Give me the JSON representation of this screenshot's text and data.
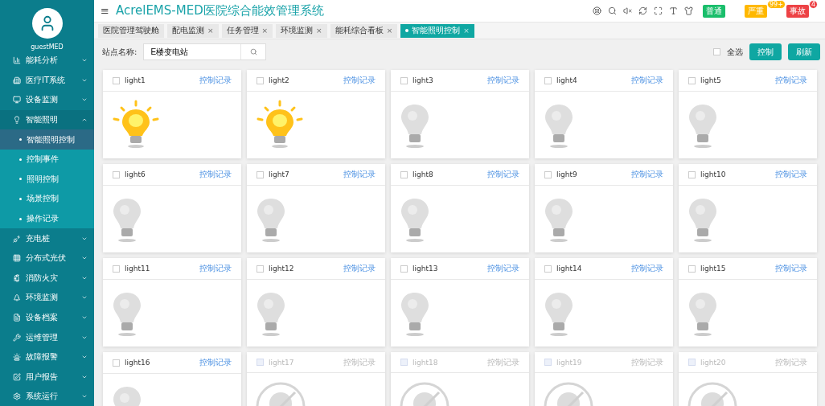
{
  "user": {
    "name": "guestMED"
  },
  "sidebar": {
    "items": [
      {
        "label": "能耗分析",
        "expanded": false
      },
      {
        "label": "医疗IT系统",
        "expanded": false
      },
      {
        "label": "设备监测",
        "expanded": false
      },
      {
        "label": "智能照明",
        "expanded": true,
        "children": [
          {
            "label": "智能照明控制",
            "selected": true
          },
          {
            "label": "控制事件",
            "selected": false
          },
          {
            "label": "照明控制",
            "selected": false
          },
          {
            "label": "场景控制",
            "selected": false
          },
          {
            "label": "操作记录",
            "selected": false
          }
        ]
      },
      {
        "label": "充电桩",
        "expanded": false
      },
      {
        "label": "分布式光伏",
        "expanded": false
      },
      {
        "label": "消防火灾",
        "expanded": false
      },
      {
        "label": "环境监测",
        "expanded": false
      },
      {
        "label": "设备档案",
        "expanded": false
      },
      {
        "label": "运维管理",
        "expanded": false
      },
      {
        "label": "故障报警",
        "expanded": false
      },
      {
        "label": "用户报告",
        "expanded": false
      },
      {
        "label": "系统运行",
        "expanded": false
      }
    ]
  },
  "header": {
    "menu_glyph": "≡",
    "title": "AcrelEMS-MED医院综合能效管理系统",
    "alerts": [
      {
        "label": "普通",
        "color": "#19be6b"
      },
      {
        "label": "严重",
        "color": "#ffb800",
        "count": "99+"
      },
      {
        "label": "事故",
        "color": "#ed4245",
        "count": "4"
      }
    ]
  },
  "tabs": [
    {
      "label": "医院管理驾驶舱",
      "selected": false,
      "closable": false
    },
    {
      "label": "配电监测",
      "selected": false,
      "closable": true
    },
    {
      "label": "任务管理",
      "selected": false,
      "closable": true
    },
    {
      "label": "环境监测",
      "selected": false,
      "closable": true
    },
    {
      "label": "能耗综合看板",
      "selected": false,
      "closable": true
    },
    {
      "label": "智能照明控制",
      "selected": true,
      "closable": true
    }
  ],
  "tab_close_glyph": "×",
  "toolbar": {
    "site_label": "站点名称:",
    "site_value": "E楼变电站",
    "select_all": {
      "label": "全选",
      "checked": false
    },
    "buttons": [
      "控制",
      "刷新"
    ]
  },
  "lights": [
    {
      "name": "light1",
      "kind": "lit",
      "checked": false,
      "link": "控制记录"
    },
    {
      "name": "light2",
      "kind": "lit",
      "checked": false,
      "link": "控制记录"
    },
    {
      "name": "light3",
      "kind": "unlit",
      "checked": false,
      "link": "控制记录"
    },
    {
      "name": "light4",
      "kind": "unlit",
      "checked": false,
      "link": "控制记录"
    },
    {
      "name": "light5",
      "kind": "unlit",
      "checked": false,
      "link": "控制记录"
    },
    {
      "name": "light6",
      "kind": "unlit",
      "checked": false,
      "link": "控制记录"
    },
    {
      "name": "light7",
      "kind": "unlit",
      "checked": false,
      "link": "控制记录"
    },
    {
      "name": "light8",
      "kind": "unlit",
      "checked": false,
      "link": "控制记录"
    },
    {
      "name": "light9",
      "kind": "unlit",
      "checked": false,
      "link": "控制记录"
    },
    {
      "name": "light10",
      "kind": "unlit",
      "checked": false,
      "link": "控制记录"
    },
    {
      "name": "light11",
      "kind": "unlit",
      "checked": false,
      "link": "控制记录"
    },
    {
      "name": "light12",
      "kind": "unlit",
      "checked": false,
      "link": "控制记录"
    },
    {
      "name": "light13",
      "kind": "unlit",
      "checked": false,
      "link": "控制记录"
    },
    {
      "name": "light14",
      "kind": "unlit",
      "checked": false,
      "link": "控制记录"
    },
    {
      "name": "light15",
      "kind": "unlit",
      "checked": false,
      "link": "控制记录"
    },
    {
      "name": "light16",
      "kind": "unlit",
      "checked": false,
      "link": "控制记录"
    },
    {
      "name": "light17",
      "kind": "offline",
      "checked": false,
      "link": "控制记录"
    },
    {
      "name": "light18",
      "kind": "offline",
      "checked": false,
      "link": "控制记录"
    },
    {
      "name": "light19",
      "kind": "offline",
      "checked": false,
      "link": "控制记录"
    },
    {
      "name": "light20",
      "kind": "offline",
      "checked": false,
      "link": "控制记录"
    }
  ]
}
